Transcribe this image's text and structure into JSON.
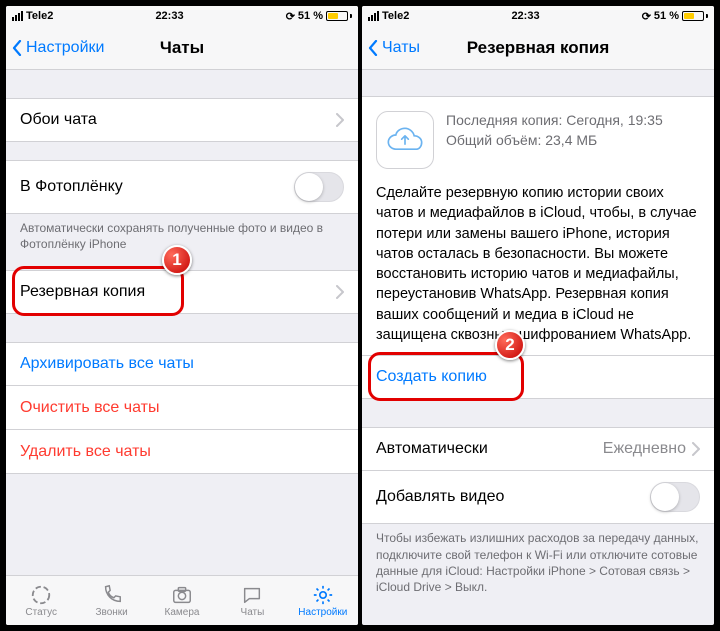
{
  "left": {
    "status": {
      "carrier": "Tele2",
      "time": "22:33",
      "battery": "51 %"
    },
    "nav": {
      "back": "Настройки",
      "title": "Чаты"
    },
    "wallpaper": "Обои чата",
    "camera_roll": {
      "label": "В Фотоплёнку",
      "note": "Автоматически сохранять полученные фото и видео в Фотоплёнку iPhone"
    },
    "backup": "Резервная копия",
    "archive": "Архивировать все чаты",
    "clear": "Очистить все чаты",
    "delete": "Удалить все чаты",
    "tabs": {
      "status": "Статус",
      "calls": "Звонки",
      "camera": "Камера",
      "chats": "Чаты",
      "settings": "Настройки"
    }
  },
  "right": {
    "status": {
      "carrier": "Tele2",
      "time": "22:33",
      "battery": "51 %"
    },
    "nav": {
      "back": "Чаты",
      "title": "Резервная копия"
    },
    "last_backup_line": "Последняя копия: Сегодня, 19:35",
    "size_line": "Общий объём: 23,4 МБ",
    "description": "Сделайте резервную копию истории своих чатов и медиафайлов в iCloud, чтобы, в случае потери или замены вашего iPhone, история чатов осталась в безопасности. Вы можете восстановить историю чатов и медиафайлы, переустановив WhatsApp. Резервная копия ваших сообщений и медиа в iCloud не защищена сквозным шифрованием WhatsApp.",
    "create": "Создать копию",
    "auto": {
      "label": "Автоматически",
      "value": "Ежедневно"
    },
    "video": "Добавлять видео",
    "video_note": "Чтобы избежать излишних расходов за передачу данных, подключите свой телефон к Wi-Fi или отключите сотовые данные для iCloud: Настройки iPhone > Сотовая связь > iCloud Drive > Выкл."
  },
  "badges": {
    "b1": "1",
    "b2": "2"
  }
}
